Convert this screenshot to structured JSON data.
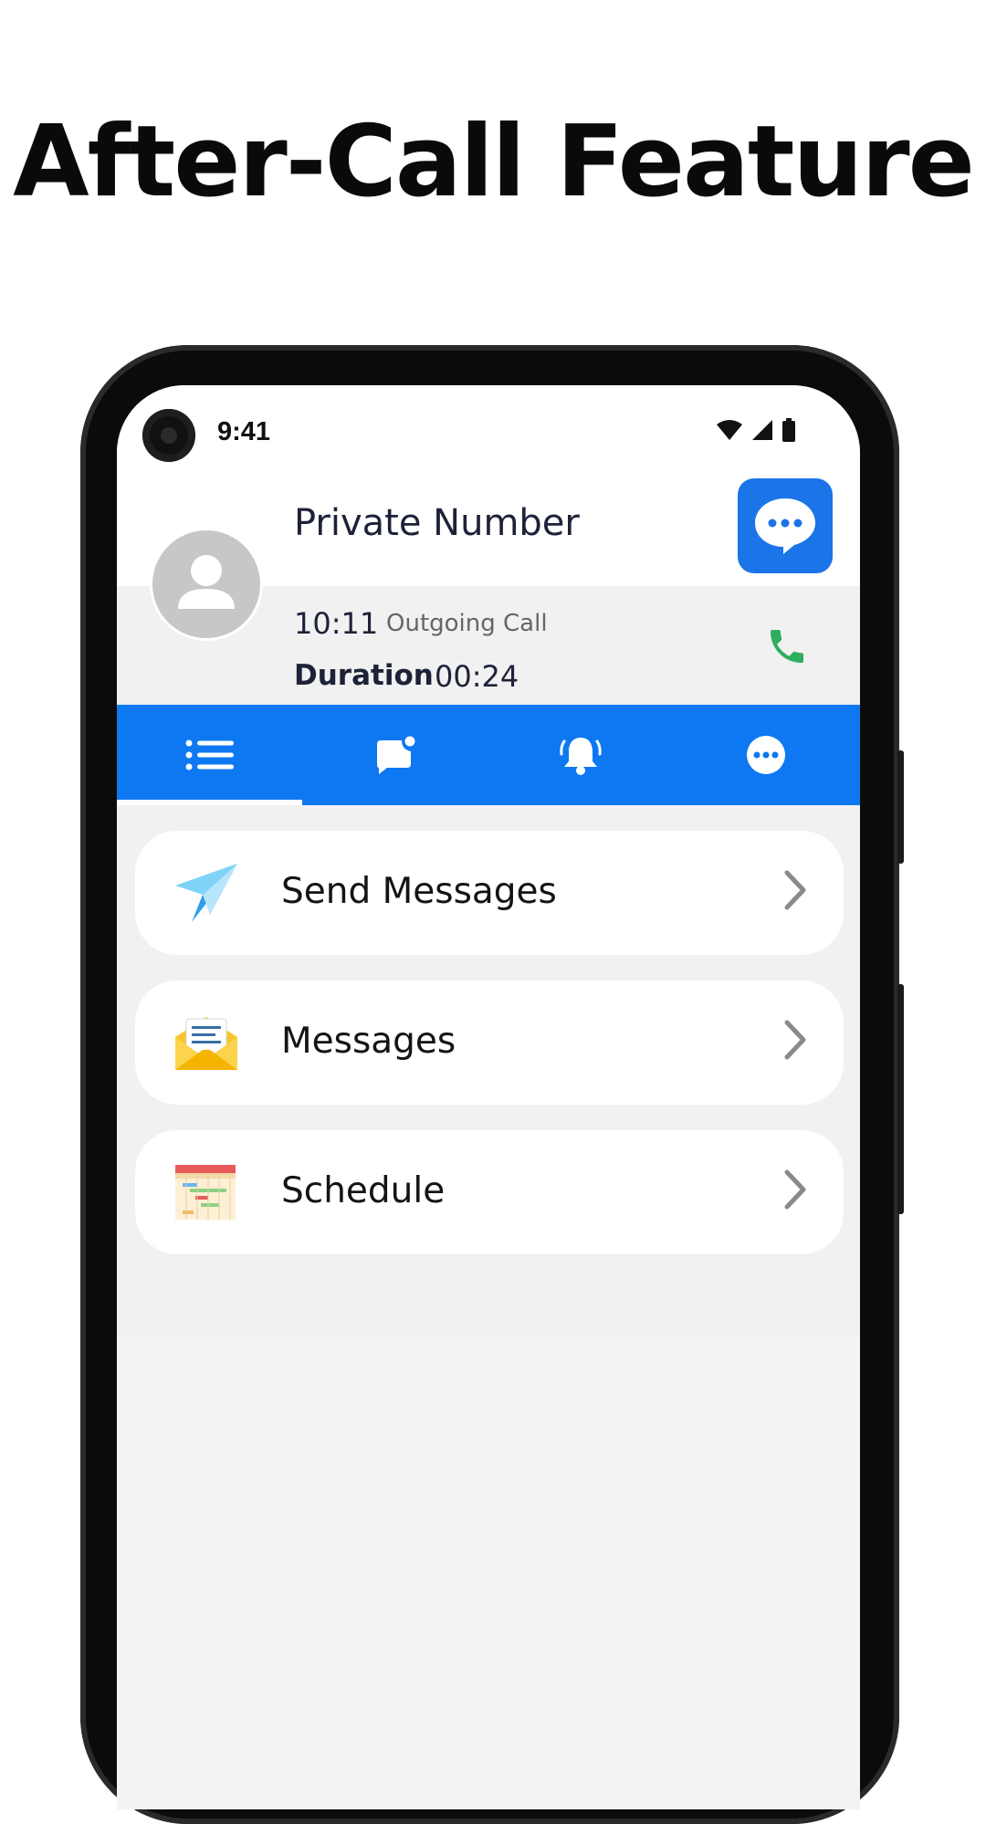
{
  "headline": "After-Call Feature",
  "status_bar": {
    "time": "9:41",
    "icons": [
      "wifi-icon",
      "cell-signal-icon",
      "battery-icon"
    ]
  },
  "caller": {
    "name": "Private Number",
    "time": "10:11",
    "call_type": "Outgoing Call",
    "duration_label": "Duration",
    "duration_value": "00:24"
  },
  "tabs": [
    {
      "icon": "list-icon",
      "selected": true
    },
    {
      "icon": "message-notification-icon",
      "selected": false
    },
    {
      "icon": "bell-ringing-icon",
      "selected": false
    },
    {
      "icon": "more-options-icon",
      "selected": false
    }
  ],
  "actions": [
    {
      "label": "Send Messages",
      "icon": "paper-plane-icon"
    },
    {
      "label": "Messages",
      "icon": "envelope-icon"
    },
    {
      "label": "Schedule",
      "icon": "calendar-icon"
    }
  ],
  "colors": {
    "tab_bar": "#0d78f2",
    "chat_button": "#1b74e8",
    "call_icon": "#2eae5f"
  }
}
